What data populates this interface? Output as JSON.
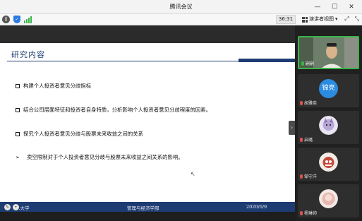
{
  "window": {
    "title": "腾讯会议"
  },
  "toolbar": {
    "timer": "36:31",
    "view_label": "演讲者视图",
    "view_arrow": "▾"
  },
  "slide": {
    "title": "研究内容",
    "bullets": [
      "构建个人投资者意见分歧指标",
      "结合公司层面特征和投资者自身特质，分析影响个人投资者意见分歧程度的因素。",
      "探究个人投资者意见分歧与股票未来收益之间的关系",
      "卖空限制对于个人投资者意见分歧与股票未来收益之间关系的影响。"
    ],
    "footer_left": "…大学",
    "footer_center": "管理与经济学部",
    "footer_right": "2020/6/9"
  },
  "participants": [
    {
      "name": "嗣嗣",
      "type": "video",
      "mic": "on"
    },
    {
      "name": "胡雅奕",
      "avatar_text": "锦亮",
      "avatar_color": "#2b8be0",
      "type": "avatar",
      "mic": "off"
    },
    {
      "name": "启璐",
      "type": "avatar-photo",
      "mic": "off"
    },
    {
      "name": "邹守洋",
      "type": "avatar-photo",
      "mic": "off"
    },
    {
      "name": "杨琳帅",
      "type": "avatar-photo",
      "mic": "off"
    }
  ],
  "colors": {
    "slide_accent": "#1e3c72",
    "active_border": "#3bb54a"
  }
}
